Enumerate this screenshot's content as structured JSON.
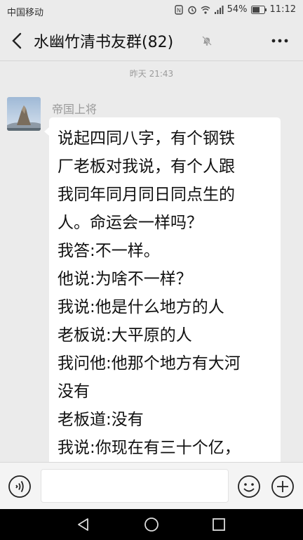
{
  "status_bar": {
    "carrier": "中国移动",
    "battery": "54%",
    "time": "11:12"
  },
  "header": {
    "title": "水幽竹清书友群(82)",
    "back_icon": "chevron-left-icon",
    "mute_icon": "bell-muted-icon",
    "more_icon": "more-horizontal-icon"
  },
  "chat": {
    "timestamp": "昨天 21:43",
    "message": {
      "sender": "帝国上将",
      "avatar": "mountain-photo-avatar",
      "lines": [
        "说起四同八字，有个钢铁",
        "厂老板对我说，有个人跟",
        "我同年同月同日同点生的",
        "人。命运会一样吗？",
        "我答:不一样。",
        "他说:为啥不一样？",
        "我说:他是什么地方的人",
        "老板说:大平原的人",
        "我问他:他那个地方有大河",
        "没有",
        "老板道:没有",
        "我说:你现在有三十个亿，"
      ]
    }
  },
  "input_bar": {
    "value": "",
    "voice_icon": "voice-icon",
    "emoji_icon": "emoji-icon",
    "plus_icon": "plus-circle-icon"
  },
  "system_nav": {
    "back": "triangle-back-icon",
    "home": "circle-home-icon",
    "recents": "square-recents-icon"
  },
  "colors": {
    "background": "#ebebeb",
    "bubble": "#ffffff",
    "nav_bar": "#000000"
  }
}
